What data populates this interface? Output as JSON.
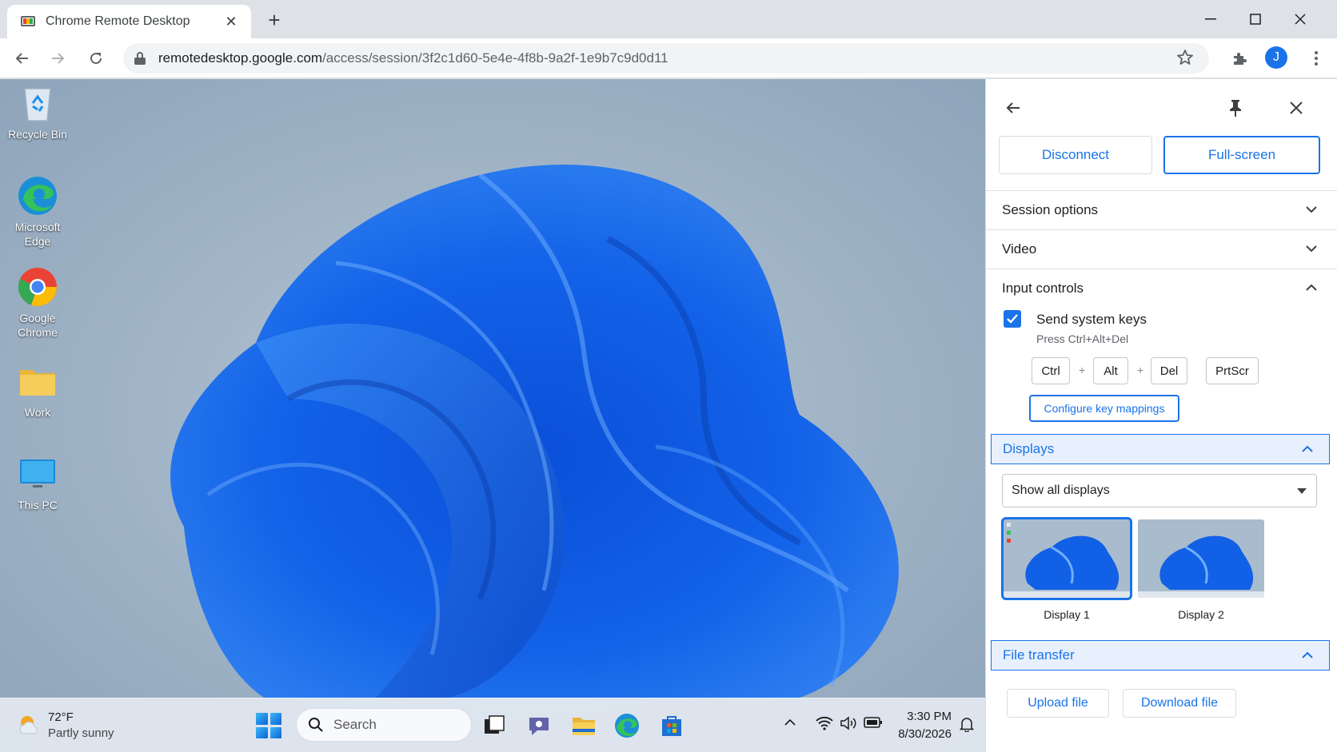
{
  "browser": {
    "tab_title": "Chrome Remote Desktop",
    "url_host": "remotedesktop.google.com",
    "url_path": "/access/session/3f2c1d60-5e4e-4f8b-9a2f-1e9b7c9d0d11",
    "profile_initial": "J"
  },
  "desktop": {
    "icons": [
      {
        "label": "Recycle Bin"
      },
      {
        "label": "Microsoft Edge"
      },
      {
        "label": "Google Chrome"
      },
      {
        "label": "Work"
      },
      {
        "label": "This PC"
      }
    ]
  },
  "taskbar": {
    "weather_temp": "72°F",
    "weather_desc": "Partly sunny",
    "search_placeholder": "Search",
    "time": "3:30 PM",
    "date": "8/30/2026"
  },
  "panel": {
    "disconnect_label": "Disconnect",
    "fullscreen_label": "Full-screen",
    "session_options_label": "Session options",
    "video_label": "Video",
    "input_controls_label": "Input controls",
    "send_system_keys_label": "Send system keys",
    "press_keys_label": "Press Ctrl+Alt+Del",
    "keys": {
      "ctrl": "Ctrl",
      "alt": "Alt",
      "del": "Del",
      "prtscr": "PrtScr",
      "plus": "+"
    },
    "configure_label": "Configure key mappings",
    "displays_label": "Displays",
    "display_select_value": "Show all displays",
    "display_1_label": "Display 1",
    "display_2_label": "Display 2",
    "file_transfer_label": "File transfer",
    "upload_label": "Upload file",
    "download_label": "Download file"
  },
  "colors": {
    "accent": "#1a73e8",
    "active_section_bg": "#e8f0fe"
  }
}
